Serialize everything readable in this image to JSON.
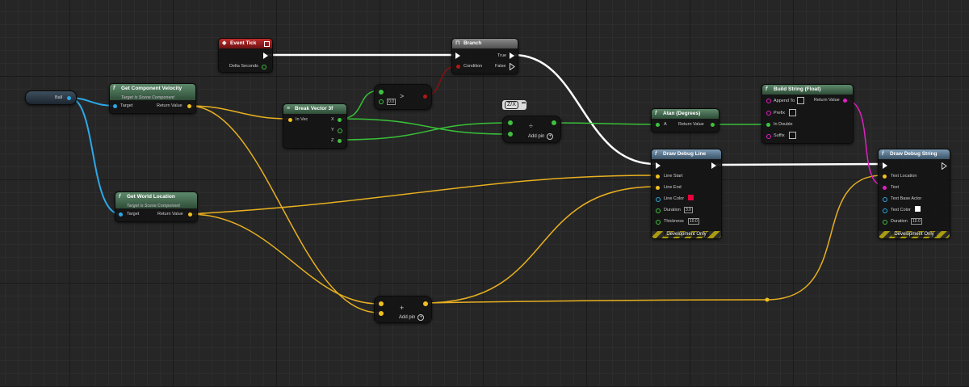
{
  "colors": {
    "exec": "#ffffff",
    "vector": "#f0c020",
    "float": "#40c040",
    "object": "#2da8e8",
    "string": "#e020c0",
    "bool": "#b01818",
    "linear_color": "#2aa8e0"
  },
  "ball": {
    "label": "Ball"
  },
  "get_velocity": {
    "title": "Get Component Velocity",
    "subtitle": "Target is Scene Component",
    "target": "Target",
    "return": "Return Value"
  },
  "get_location": {
    "title": "Get World Location",
    "subtitle": "Target is Scene Component",
    "target": "Target",
    "return": "Return Value"
  },
  "event_tick": {
    "title": "Event Tick",
    "delta": "Delta Seconds"
  },
  "branch": {
    "title": "Branch",
    "condition": "Condition",
    "true_label": "True",
    "false_label": "False"
  },
  "compare": {
    "op": ">",
    "value": "0.0"
  },
  "break_vector": {
    "title": "Break Vector 3f",
    "in": "In Vec",
    "x": "X",
    "y": "Y",
    "z": "Z"
  },
  "divide": {
    "tooltip": "Z/X",
    "op": "÷",
    "add_pin": "Add pin"
  },
  "add": {
    "op": "+",
    "add_pin": "Add pin"
  },
  "atan": {
    "title": "Atan (Degrees)",
    "a": "A",
    "return": "Return Value"
  },
  "build_string": {
    "title": "Build String (Float)",
    "append_to": "Append To",
    "prefix": "Prefix",
    "in_double": "In Double",
    "suffix": "Suffix",
    "return": "Return Value"
  },
  "draw_line": {
    "title": "Draw Debug Line",
    "start": "Line Start",
    "end": "Line End",
    "color": "Line Color",
    "duration": "Duration",
    "duration_val": "3.0",
    "thickness": "Thickness",
    "thickness_val": "10.0",
    "dev": "Development Only"
  },
  "draw_string": {
    "title": "Draw Debug String",
    "location": "Text Location",
    "text": "Text",
    "actor": "Text Base Actor",
    "color": "Text Color",
    "duration": "Duration",
    "duration_val": "10.0",
    "dev": "Development Only"
  }
}
